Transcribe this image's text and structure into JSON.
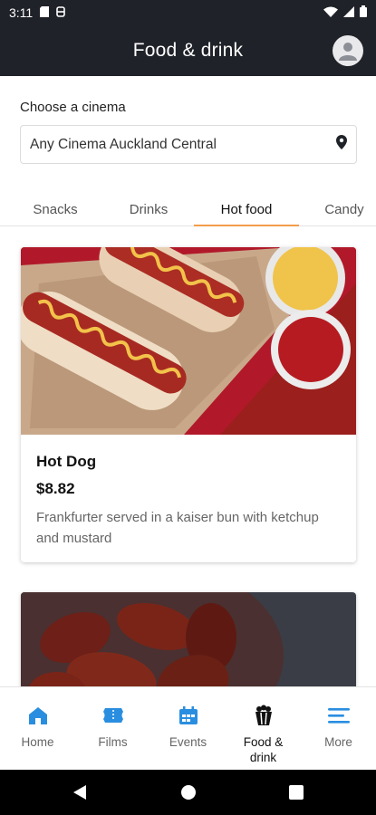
{
  "status_bar": {
    "time": "3:11"
  },
  "app_bar": {
    "title": "Food & drink"
  },
  "cinema": {
    "label": "Choose a cinema",
    "selected": "Any Cinema Auckland Central"
  },
  "tabs": [
    {
      "label": "Snacks",
      "active": false
    },
    {
      "label": "Drinks",
      "active": false
    },
    {
      "label": "Hot food",
      "active": true
    },
    {
      "label": "Candy",
      "active": false
    }
  ],
  "products": [
    {
      "name": "Hot Dog",
      "price": "$8.82",
      "description": "Frankfurter served in a kaiser bun with ketchup and mustard"
    }
  ],
  "bottom_nav": [
    {
      "label": "Home",
      "icon": "home-icon",
      "active": false
    },
    {
      "label": "Films",
      "icon": "ticket-icon",
      "active": false
    },
    {
      "label": "Events",
      "icon": "calendar-icon",
      "active": false
    },
    {
      "label": "Food & drink",
      "icon": "popcorn-icon",
      "active": true
    },
    {
      "label": "More",
      "icon": "menu-icon",
      "active": false
    }
  ],
  "colors": {
    "header_bg": "#1f2228",
    "accent": "#2a8ee0",
    "tab_indicator": "#f29d4b"
  }
}
